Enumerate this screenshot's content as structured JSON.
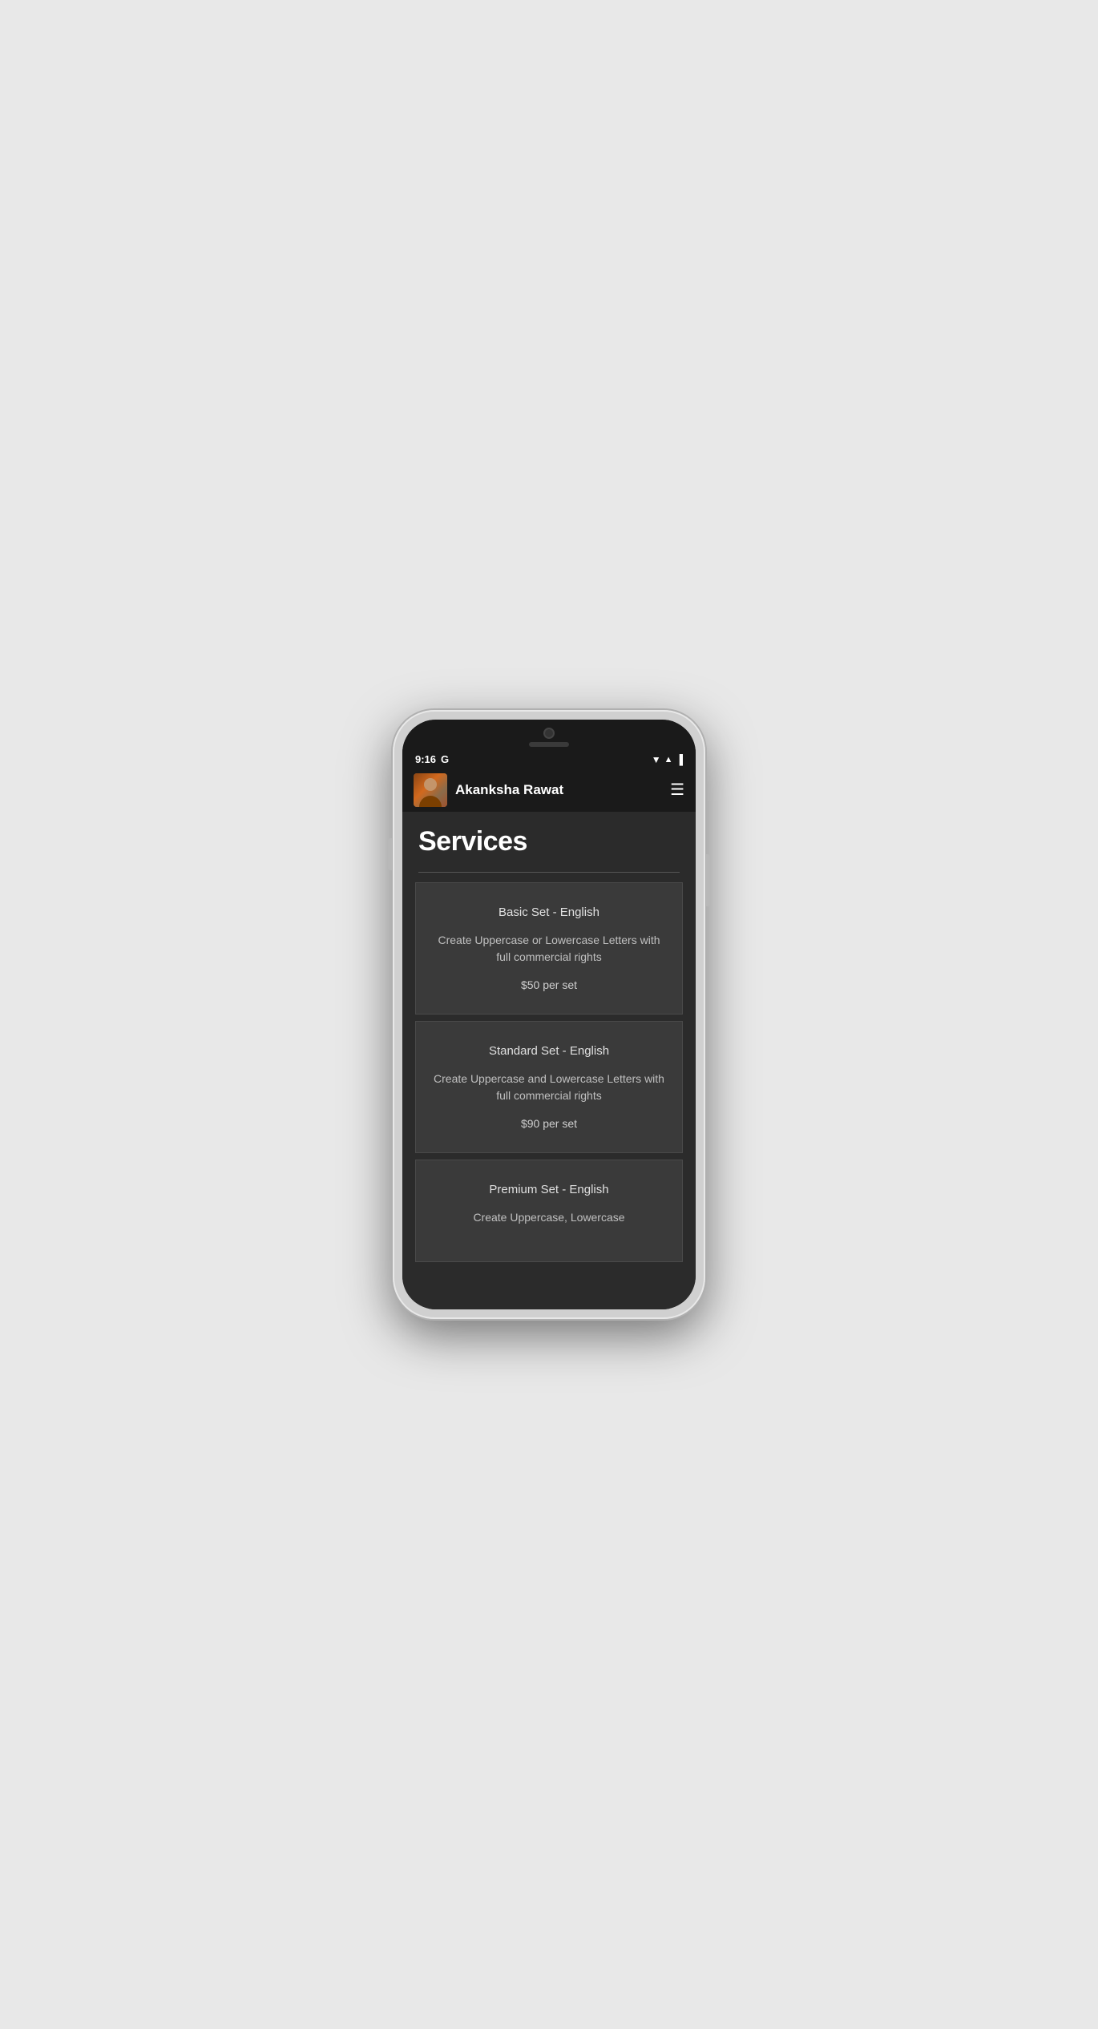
{
  "status_bar": {
    "time": "9:16",
    "carrier": "G",
    "icons": [
      "wifi",
      "signal",
      "battery"
    ]
  },
  "header": {
    "user_name": "Akanksha Rawat",
    "menu_icon": "☰"
  },
  "page": {
    "title": "Services",
    "divider": true
  },
  "services": [
    {
      "id": 1,
      "title": "Basic Set - English",
      "description": "Create Uppercase or Lowercase Letters with full commercial rights",
      "price": "$50 per set"
    },
    {
      "id": 2,
      "title": "Standard Set - English",
      "description": "Create Uppercase and Lowercase Letters with full commercial rights",
      "price": "$90 per set"
    },
    {
      "id": 3,
      "title": "Premium Set - English",
      "description": "Create Uppercase, Lowercase",
      "price": ""
    }
  ]
}
